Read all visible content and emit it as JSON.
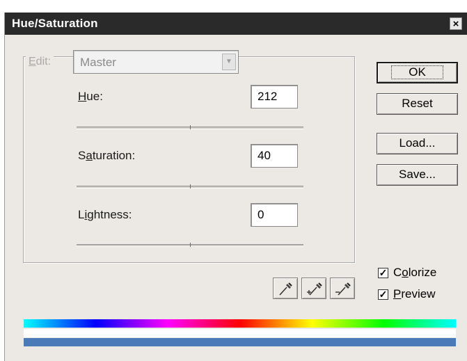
{
  "window": {
    "title": "Hue/Saturation",
    "close_glyph": "×"
  },
  "edit": {
    "label": "Edit:",
    "label_first": "E",
    "label_rest": "dit:",
    "value": "Master"
  },
  "fields": {
    "hue": {
      "label_u": "H",
      "label_rest": "ue:",
      "value": "212",
      "slider_fraction": 0.5
    },
    "saturation": {
      "label_pre": "S",
      "label_u": "a",
      "label_rest": "turation:",
      "value": "40",
      "slider_fraction": 0.5
    },
    "lightness": {
      "label_pre": "L",
      "label_u": "i",
      "label_rest": "ghtness:",
      "value": "0",
      "slider_fraction": 0.5
    }
  },
  "buttons": {
    "ok": "OK",
    "reset": "Reset",
    "load": "Load...",
    "save": "Save..."
  },
  "checkboxes": {
    "colorize": {
      "label_pre": "C",
      "label_u": "o",
      "label_rest": "lorize",
      "checked": true
    },
    "preview": {
      "label_u": "P",
      "label_rest": "review",
      "checked": true
    }
  },
  "eyedroppers": [
    "eyedropper-icon",
    "eyedropper-plus-icon",
    "eyedropper-minus-icon"
  ],
  "colors": {
    "spectrum": [
      "#00ffff",
      "#0000ff",
      "#ff00ff",
      "#ff0000",
      "#ffff00",
      "#00ff00",
      "#00ffff"
    ],
    "result_bar": "#4a7ab8"
  }
}
